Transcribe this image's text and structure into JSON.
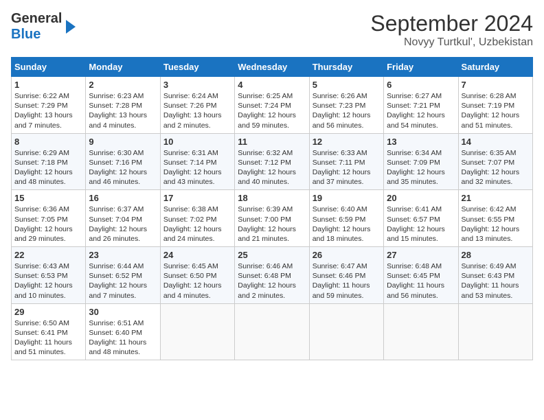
{
  "header": {
    "logo_line1": "General",
    "logo_line2": "Blue",
    "month_year": "September 2024",
    "location": "Novyy Turtkul', Uzbekistan"
  },
  "weekdays": [
    "Sunday",
    "Monday",
    "Tuesday",
    "Wednesday",
    "Thursday",
    "Friday",
    "Saturday"
  ],
  "weeks": [
    [
      {
        "day": "1",
        "lines": [
          "Sunrise: 6:22 AM",
          "Sunset: 7:29 PM",
          "Daylight: 13 hours",
          "and 7 minutes."
        ]
      },
      {
        "day": "2",
        "lines": [
          "Sunrise: 6:23 AM",
          "Sunset: 7:28 PM",
          "Daylight: 13 hours",
          "and 4 minutes."
        ]
      },
      {
        "day": "3",
        "lines": [
          "Sunrise: 6:24 AM",
          "Sunset: 7:26 PM",
          "Daylight: 13 hours",
          "and 2 minutes."
        ]
      },
      {
        "day": "4",
        "lines": [
          "Sunrise: 6:25 AM",
          "Sunset: 7:24 PM",
          "Daylight: 12 hours",
          "and 59 minutes."
        ]
      },
      {
        "day": "5",
        "lines": [
          "Sunrise: 6:26 AM",
          "Sunset: 7:23 PM",
          "Daylight: 12 hours",
          "and 56 minutes."
        ]
      },
      {
        "day": "6",
        "lines": [
          "Sunrise: 6:27 AM",
          "Sunset: 7:21 PM",
          "Daylight: 12 hours",
          "and 54 minutes."
        ]
      },
      {
        "day": "7",
        "lines": [
          "Sunrise: 6:28 AM",
          "Sunset: 7:19 PM",
          "Daylight: 12 hours",
          "and 51 minutes."
        ]
      }
    ],
    [
      {
        "day": "8",
        "lines": [
          "Sunrise: 6:29 AM",
          "Sunset: 7:18 PM",
          "Daylight: 12 hours",
          "and 48 minutes."
        ]
      },
      {
        "day": "9",
        "lines": [
          "Sunrise: 6:30 AM",
          "Sunset: 7:16 PM",
          "Daylight: 12 hours",
          "and 46 minutes."
        ]
      },
      {
        "day": "10",
        "lines": [
          "Sunrise: 6:31 AM",
          "Sunset: 7:14 PM",
          "Daylight: 12 hours",
          "and 43 minutes."
        ]
      },
      {
        "day": "11",
        "lines": [
          "Sunrise: 6:32 AM",
          "Sunset: 7:12 PM",
          "Daylight: 12 hours",
          "and 40 minutes."
        ]
      },
      {
        "day": "12",
        "lines": [
          "Sunrise: 6:33 AM",
          "Sunset: 7:11 PM",
          "Daylight: 12 hours",
          "and 37 minutes."
        ]
      },
      {
        "day": "13",
        "lines": [
          "Sunrise: 6:34 AM",
          "Sunset: 7:09 PM",
          "Daylight: 12 hours",
          "and 35 minutes."
        ]
      },
      {
        "day": "14",
        "lines": [
          "Sunrise: 6:35 AM",
          "Sunset: 7:07 PM",
          "Daylight: 12 hours",
          "and 32 minutes."
        ]
      }
    ],
    [
      {
        "day": "15",
        "lines": [
          "Sunrise: 6:36 AM",
          "Sunset: 7:05 PM",
          "Daylight: 12 hours",
          "and 29 minutes."
        ]
      },
      {
        "day": "16",
        "lines": [
          "Sunrise: 6:37 AM",
          "Sunset: 7:04 PM",
          "Daylight: 12 hours",
          "and 26 minutes."
        ]
      },
      {
        "day": "17",
        "lines": [
          "Sunrise: 6:38 AM",
          "Sunset: 7:02 PM",
          "Daylight: 12 hours",
          "and 24 minutes."
        ]
      },
      {
        "day": "18",
        "lines": [
          "Sunrise: 6:39 AM",
          "Sunset: 7:00 PM",
          "Daylight: 12 hours",
          "and 21 minutes."
        ]
      },
      {
        "day": "19",
        "lines": [
          "Sunrise: 6:40 AM",
          "Sunset: 6:59 PM",
          "Daylight: 12 hours",
          "and 18 minutes."
        ]
      },
      {
        "day": "20",
        "lines": [
          "Sunrise: 6:41 AM",
          "Sunset: 6:57 PM",
          "Daylight: 12 hours",
          "and 15 minutes."
        ]
      },
      {
        "day": "21",
        "lines": [
          "Sunrise: 6:42 AM",
          "Sunset: 6:55 PM",
          "Daylight: 12 hours",
          "and 13 minutes."
        ]
      }
    ],
    [
      {
        "day": "22",
        "lines": [
          "Sunrise: 6:43 AM",
          "Sunset: 6:53 PM",
          "Daylight: 12 hours",
          "and 10 minutes."
        ]
      },
      {
        "day": "23",
        "lines": [
          "Sunrise: 6:44 AM",
          "Sunset: 6:52 PM",
          "Daylight: 12 hours",
          "and 7 minutes."
        ]
      },
      {
        "day": "24",
        "lines": [
          "Sunrise: 6:45 AM",
          "Sunset: 6:50 PM",
          "Daylight: 12 hours",
          "and 4 minutes."
        ]
      },
      {
        "day": "25",
        "lines": [
          "Sunrise: 6:46 AM",
          "Sunset: 6:48 PM",
          "Daylight: 12 hours",
          "and 2 minutes."
        ]
      },
      {
        "day": "26",
        "lines": [
          "Sunrise: 6:47 AM",
          "Sunset: 6:46 PM",
          "Daylight: 11 hours",
          "and 59 minutes."
        ]
      },
      {
        "day": "27",
        "lines": [
          "Sunrise: 6:48 AM",
          "Sunset: 6:45 PM",
          "Daylight: 11 hours",
          "and 56 minutes."
        ]
      },
      {
        "day": "28",
        "lines": [
          "Sunrise: 6:49 AM",
          "Sunset: 6:43 PM",
          "Daylight: 11 hours",
          "and 53 minutes."
        ]
      }
    ],
    [
      {
        "day": "29",
        "lines": [
          "Sunrise: 6:50 AM",
          "Sunset: 6:41 PM",
          "Daylight: 11 hours",
          "and 51 minutes."
        ]
      },
      {
        "day": "30",
        "lines": [
          "Sunrise: 6:51 AM",
          "Sunset: 6:40 PM",
          "Daylight: 11 hours",
          "and 48 minutes."
        ]
      },
      {
        "day": "",
        "lines": []
      },
      {
        "day": "",
        "lines": []
      },
      {
        "day": "",
        "lines": []
      },
      {
        "day": "",
        "lines": []
      },
      {
        "day": "",
        "lines": []
      }
    ]
  ]
}
